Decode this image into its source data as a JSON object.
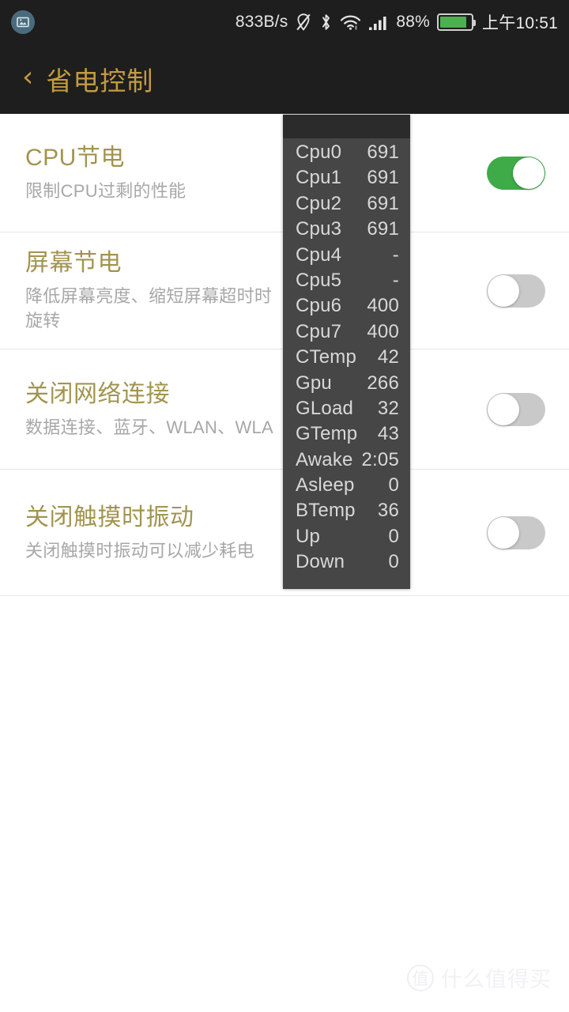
{
  "status_bar": {
    "notification_icon": "screenshot-notification-icon",
    "net_speed": "833B/s",
    "icons": [
      "location-off-icon",
      "bluetooth-icon",
      "wifi-icon",
      "signal-bars-icon"
    ],
    "battery_percent": "88%",
    "battery_level": 88,
    "clock": "上午10:51",
    "bg_color": "#1e1e1e",
    "battery_color": "#4caf50"
  },
  "header": {
    "back_label": "‹",
    "title": "省电控制",
    "title_color": "#c49b3f",
    "bg_color": "#1e1e1e"
  },
  "list": {
    "rows": [
      {
        "title": "CPU节电",
        "subtitle": "限制CPU过剩的性能",
        "toggle_state": "on",
        "toggle_label": "开"
      },
      {
        "title": "屏幕节电",
        "subtitle": "降低屏幕亮度、缩短屏幕超时时\n旋转",
        "toggle_state": "off",
        "toggle_label": "关"
      },
      {
        "title": "关闭网络连接",
        "subtitle": "数据连接、蓝牙、WLAN、WLA",
        "toggle_state": "off",
        "toggle_label": "关"
      },
      {
        "title": "关闭触摸时振动",
        "subtitle": "关闭触摸时振动可以减少耗电",
        "toggle_state": "off",
        "toggle_label": "关"
      }
    ],
    "title_color": "#a2944f",
    "subtitle_color": "#a7a7a7",
    "switch_on_color": "#3eab48",
    "switch_off_color": "#c9c9c9"
  },
  "cpu_overlay": {
    "bg_color": "#464646",
    "header_color": "#2b2b2b",
    "text_color": "#d8d8d8",
    "rows": [
      {
        "key": "Cpu0",
        "value": "691"
      },
      {
        "key": "Cpu1",
        "value": "691"
      },
      {
        "key": "Cpu2",
        "value": "691"
      },
      {
        "key": "Cpu3",
        "value": "691"
      },
      {
        "key": "Cpu4",
        "value": "-"
      },
      {
        "key": "Cpu5",
        "value": "-"
      },
      {
        "key": "Cpu6",
        "value": "400"
      },
      {
        "key": "Cpu7",
        "value": "400"
      },
      {
        "key": "CTemp",
        "value": "42"
      },
      {
        "key": "Gpu",
        "value": "266"
      },
      {
        "key": "GLoad",
        "value": "32"
      },
      {
        "key": "GTemp",
        "value": "43"
      },
      {
        "key": "Awake",
        "value": "2:05"
      },
      {
        "key": "Asleep",
        "value": "0"
      },
      {
        "key": "BTemp",
        "value": "36"
      },
      {
        "key": "Up",
        "value": "0"
      },
      {
        "key": "Down",
        "value": "0"
      }
    ]
  },
  "watermark": {
    "logo_glyph": "值",
    "text": "什么值得买"
  }
}
